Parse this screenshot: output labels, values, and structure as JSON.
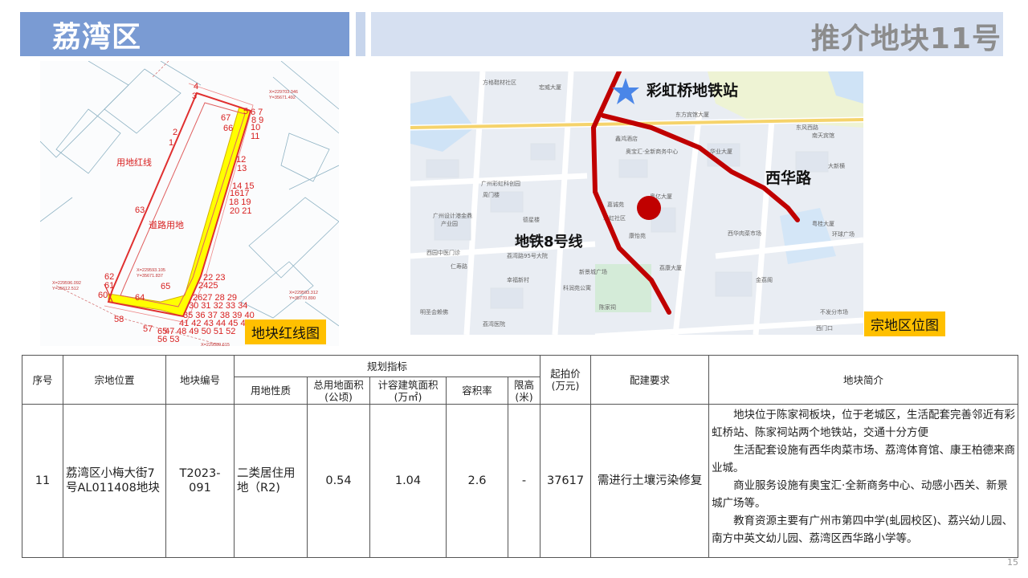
{
  "header": {
    "district": "荔湾区",
    "parcel_title": "推介地块11号"
  },
  "redline_map": {
    "tag": "地块红线图",
    "labels": {
      "land_redline": "用地红线",
      "road_land": "道路用地",
      "coord_top": "X=229703.346\nY=35671.492",
      "coord_mid": "X=229593.105\nY=35671.837",
      "coord_left": "X=229596.092\nY=35612.512",
      "coord_right": "X=229593.312\nY=35770.890",
      "coord_bottom": "X=229589.615"
    },
    "point_numbers": [
      "1",
      "2",
      "3",
      "4",
      "5",
      "6",
      "7",
      "8",
      "9",
      "10",
      "11",
      "12",
      "13",
      "14",
      "15",
      "16",
      "17",
      "18",
      "19",
      "20",
      "21",
      "22",
      "23",
      "24",
      "25",
      "26",
      "27",
      "28",
      "29",
      "30",
      "31",
      "32",
      "33",
      "34",
      "35",
      "36",
      "37",
      "38",
      "39",
      "40",
      "41",
      "42",
      "43",
      "44",
      "45",
      "46",
      "47",
      "48",
      "49",
      "50",
      "51",
      "52",
      "53",
      "54",
      "55",
      "56",
      "57",
      "58",
      "59",
      "60",
      "61",
      "62",
      "63",
      "64",
      "65",
      "66",
      "67"
    ]
  },
  "location_map": {
    "tag": "宗地区位图",
    "metro_station": "彩虹桥地铁站",
    "road_name": "西华路",
    "metro_line": "地铁8号线",
    "pois": [
      "方格鞋材社区",
      "宏威大厦",
      "东方宾馆大厦",
      "鑫鸿酒店",
      "奥宝汇·全新商务中心",
      "西华大厦",
      "广州彩虹科创园",
      "广州设计港金鼎产业园",
      "德星楼",
      "嘉诚苑",
      "彩虹社区",
      "荔湾路95号大院",
      "康怡苑",
      "新景城广场",
      "科润苑公寓",
      "幸福新村",
      "西华肉菜市场",
      "环球广场",
      "金荔阁",
      "荔湾医院",
      "陈家祠",
      "东风西路",
      "南天宾馆",
      "华业大厦",
      "文昌楼",
      "西园中医门诊",
      "仁寿路",
      "明圣会赖佛"
    ],
    "colors": {
      "line": "#c00000",
      "marker": "#c00000",
      "star": "#4a86e8"
    }
  },
  "table": {
    "headers": {
      "seq": "序号",
      "location": "宗地位置",
      "parcel_no": "地块编号",
      "planning": "规划指标",
      "land_use": "用地性质",
      "total_area": "总用地面积\n(公顷)",
      "gfa": "计容建筑面积\n(万㎡)",
      "far": "容积率",
      "height": "限高\n(米)",
      "start_price": "起拍价\n(万元)",
      "requirement": "配建要求",
      "summary": "地块简介"
    },
    "row": {
      "seq": "11",
      "location": "荔湾区小梅大街7号AL011408地块",
      "parcel_no": "T2023-091",
      "land_use": "二类居住用地（R2)",
      "total_area": "0.54",
      "gfa": "1.04",
      "far": "2.6",
      "height": "-",
      "start_price": "37617",
      "requirement": "需进行土壤污染修复",
      "summary": [
        "地块位于陈家祠板块，位于老城区，生活配套完善邻近有彩虹桥站、陈家祠站两个地铁站，交通十分方便",
        "生活配套设施有西华肉菜市场、荔湾体育馆、康王柏德来商业城。",
        "商业服务设施有奥宝汇·全新商务中心、动感小西关、新景城广场等。",
        "教育资源主要有广州市第四中学(虬园校区)、荔兴幼儿园、南方中英文幼儿园、荔湾区西华路小学等。"
      ]
    }
  },
  "page_number": "15"
}
